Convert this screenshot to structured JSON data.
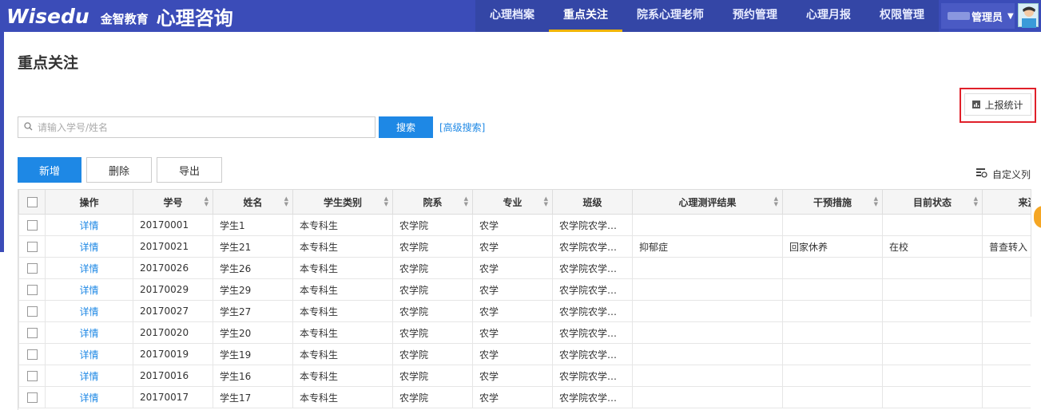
{
  "brand": {
    "logo_text": "Wisedu",
    "logo_cn": "金智教育",
    "app_name": "心理咨询"
  },
  "nav": {
    "items": [
      {
        "label": "心理档案",
        "active": false
      },
      {
        "label": "重点关注",
        "active": true
      },
      {
        "label": "院系心理老师",
        "active": false
      },
      {
        "label": "预约管理",
        "active": false
      },
      {
        "label": "心理月报",
        "active": false
      },
      {
        "label": "权限管理",
        "active": false
      }
    ]
  },
  "user": {
    "role": "管理员"
  },
  "page": {
    "title": "重点关注"
  },
  "toolbar": {
    "report_label": "上报统计",
    "search_placeholder": "请输入学号/姓名",
    "search_button": "搜索",
    "advanced_search": "[高级搜索]",
    "add_label": "新增",
    "delete_label": "删除",
    "export_label": "导出",
    "custom_columns": "自定义列"
  },
  "table": {
    "columns": [
      "操作",
      "学号",
      "姓名",
      "学生类别",
      "院系",
      "专业",
      "班级",
      "心理测评结果",
      "干预措施",
      "目前状态",
      "来源"
    ],
    "action_label": "详情",
    "rows": [
      {
        "id": "20170001",
        "name": "学生1",
        "type": "本专科生",
        "dept": "农学院",
        "major": "农学",
        "class": "农学院农学班...",
        "result": "",
        "measure": "",
        "status": "",
        "source": ""
      },
      {
        "id": "20170021",
        "name": "学生21",
        "type": "本专科生",
        "dept": "农学院",
        "major": "农学",
        "class": "农学院农学班...",
        "result": "抑郁症",
        "measure": "回家休养",
        "status": "在校",
        "source": "普查转入"
      },
      {
        "id": "20170026",
        "name": "学生26",
        "type": "本专科生",
        "dept": "农学院",
        "major": "农学",
        "class": "农学院农学班...",
        "result": "",
        "measure": "",
        "status": "",
        "source": ""
      },
      {
        "id": "20170029",
        "name": "学生29",
        "type": "本专科生",
        "dept": "农学院",
        "major": "农学",
        "class": "农学院农学班...",
        "result": "",
        "measure": "",
        "status": "",
        "source": ""
      },
      {
        "id": "20170027",
        "name": "学生27",
        "type": "本专科生",
        "dept": "农学院",
        "major": "农学",
        "class": "农学院农学班...",
        "result": "",
        "measure": "",
        "status": "",
        "source": ""
      },
      {
        "id": "20170020",
        "name": "学生20",
        "type": "本专科生",
        "dept": "农学院",
        "major": "农学",
        "class": "农学院农学班...",
        "result": "",
        "measure": "",
        "status": "",
        "source": ""
      },
      {
        "id": "20170019",
        "name": "学生19",
        "type": "本专科生",
        "dept": "农学院",
        "major": "农学",
        "class": "农学院农学班...",
        "result": "",
        "measure": "",
        "status": "",
        "source": ""
      },
      {
        "id": "20170016",
        "name": "学生16",
        "type": "本专科生",
        "dept": "农学院",
        "major": "农学",
        "class": "农学院农学班...",
        "result": "",
        "measure": "",
        "status": "",
        "source": ""
      },
      {
        "id": "20170017",
        "name": "学生17",
        "type": "本专科生",
        "dept": "农学院",
        "major": "农学",
        "class": "农学院农学班...",
        "result": "",
        "measure": "",
        "status": "",
        "source": ""
      }
    ]
  }
}
